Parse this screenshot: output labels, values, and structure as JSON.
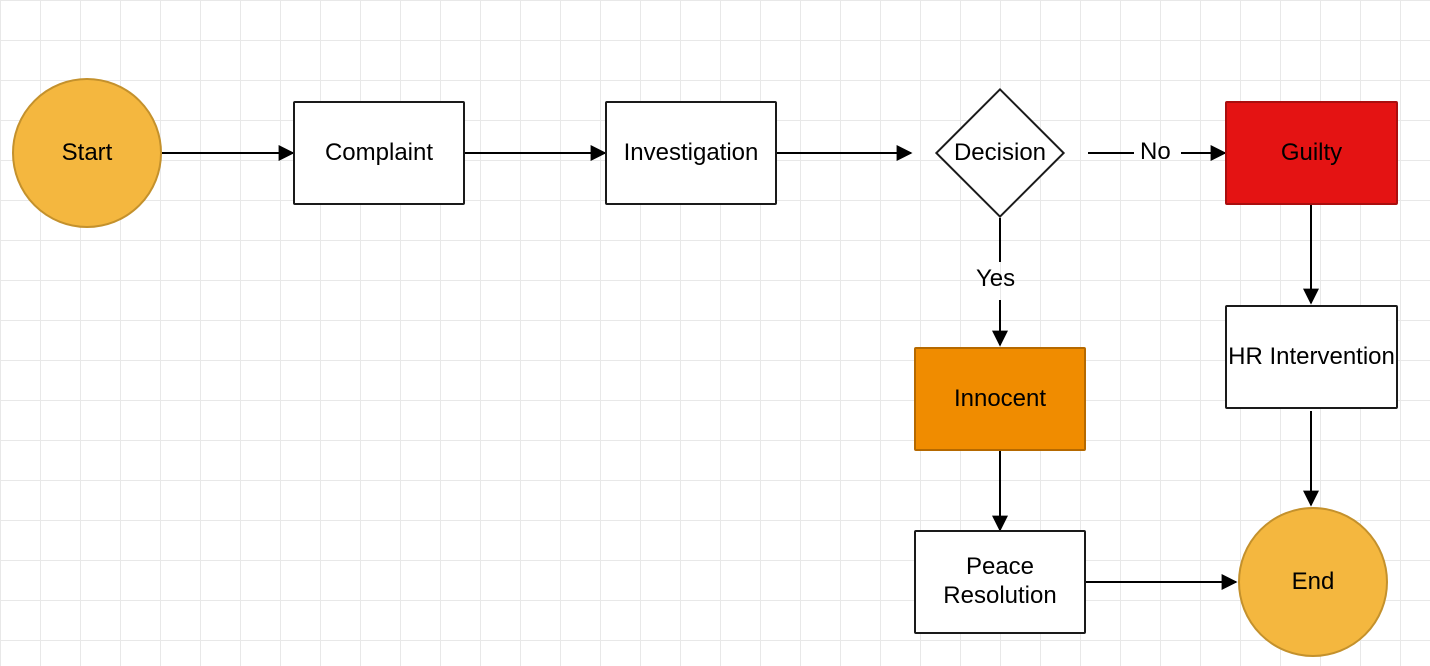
{
  "nodes": {
    "start": {
      "label": "Start"
    },
    "complaint": {
      "label": "Complaint"
    },
    "investigation": {
      "label": "Investigation"
    },
    "decision": {
      "label": "Decision"
    },
    "guilty": {
      "label": "Guilty"
    },
    "innocent": {
      "label": "Innocent"
    },
    "hr": {
      "label": "HR Intervention"
    },
    "peace": {
      "label": "Peace Resolution"
    },
    "end": {
      "label": "End"
    }
  },
  "edge_labels": {
    "decision_no": "No",
    "decision_yes": "Yes"
  },
  "colors": {
    "start_fill": "#f4b73f",
    "end_fill": "#f4b73f",
    "innocent_fill": "#f08c00",
    "guilty_fill": "#e41313",
    "node_stroke": "#1a1a1a",
    "grid": "#e8e8e8"
  }
}
